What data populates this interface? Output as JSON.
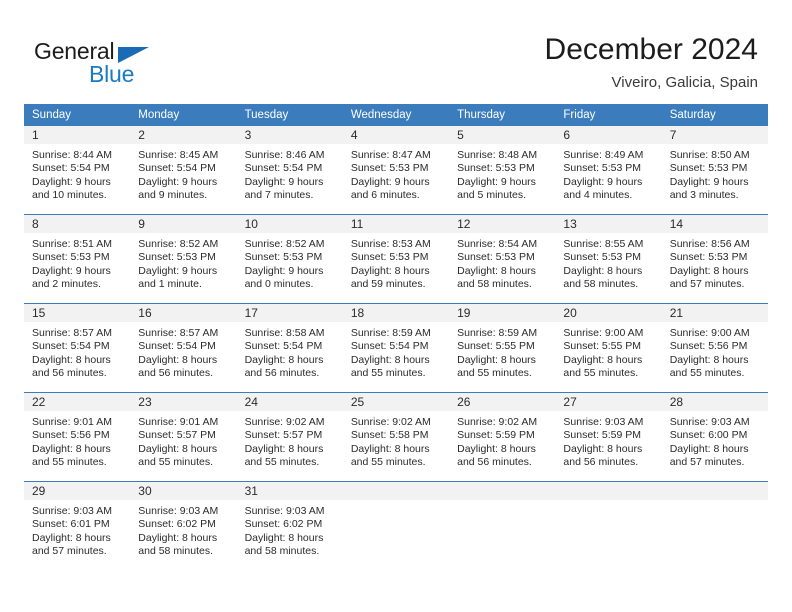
{
  "brand": {
    "name_part1": "General",
    "name_part2": "Blue",
    "triangle_color": "#1a6bb5",
    "blue_color": "#1a7ac4"
  },
  "header": {
    "title": "December 2024",
    "subtitle": "Viveiro, Galicia, Spain"
  },
  "theme": {
    "header_row_color": "#3b7cbd",
    "day_number_band": "#f2f2f2",
    "text_color": "#2b2b2b"
  },
  "calendar": {
    "weekday_headers": [
      "Sunday",
      "Monday",
      "Tuesday",
      "Wednesday",
      "Thursday",
      "Friday",
      "Saturday"
    ],
    "weeks": [
      [
        {
          "day": "1",
          "lines": [
            "Sunrise: 8:44 AM",
            "Sunset: 5:54 PM",
            "Daylight: 9 hours",
            "and 10 minutes."
          ]
        },
        {
          "day": "2",
          "lines": [
            "Sunrise: 8:45 AM",
            "Sunset: 5:54 PM",
            "Daylight: 9 hours",
            "and 9 minutes."
          ]
        },
        {
          "day": "3",
          "lines": [
            "Sunrise: 8:46 AM",
            "Sunset: 5:54 PM",
            "Daylight: 9 hours",
            "and 7 minutes."
          ]
        },
        {
          "day": "4",
          "lines": [
            "Sunrise: 8:47 AM",
            "Sunset: 5:53 PM",
            "Daylight: 9 hours",
            "and 6 minutes."
          ]
        },
        {
          "day": "5",
          "lines": [
            "Sunrise: 8:48 AM",
            "Sunset: 5:53 PM",
            "Daylight: 9 hours",
            "and 5 minutes."
          ]
        },
        {
          "day": "6",
          "lines": [
            "Sunrise: 8:49 AM",
            "Sunset: 5:53 PM",
            "Daylight: 9 hours",
            "and 4 minutes."
          ]
        },
        {
          "day": "7",
          "lines": [
            "Sunrise: 8:50 AM",
            "Sunset: 5:53 PM",
            "Daylight: 9 hours",
            "and 3 minutes."
          ]
        }
      ],
      [
        {
          "day": "8",
          "lines": [
            "Sunrise: 8:51 AM",
            "Sunset: 5:53 PM",
            "Daylight: 9 hours",
            "and 2 minutes."
          ]
        },
        {
          "day": "9",
          "lines": [
            "Sunrise: 8:52 AM",
            "Sunset: 5:53 PM",
            "Daylight: 9 hours",
            "and 1 minute."
          ]
        },
        {
          "day": "10",
          "lines": [
            "Sunrise: 8:52 AM",
            "Sunset: 5:53 PM",
            "Daylight: 9 hours",
            "and 0 minutes."
          ]
        },
        {
          "day": "11",
          "lines": [
            "Sunrise: 8:53 AM",
            "Sunset: 5:53 PM",
            "Daylight: 8 hours",
            "and 59 minutes."
          ]
        },
        {
          "day": "12",
          "lines": [
            "Sunrise: 8:54 AM",
            "Sunset: 5:53 PM",
            "Daylight: 8 hours",
            "and 58 minutes."
          ]
        },
        {
          "day": "13",
          "lines": [
            "Sunrise: 8:55 AM",
            "Sunset: 5:53 PM",
            "Daylight: 8 hours",
            "and 58 minutes."
          ]
        },
        {
          "day": "14",
          "lines": [
            "Sunrise: 8:56 AM",
            "Sunset: 5:53 PM",
            "Daylight: 8 hours",
            "and 57 minutes."
          ]
        }
      ],
      [
        {
          "day": "15",
          "lines": [
            "Sunrise: 8:57 AM",
            "Sunset: 5:54 PM",
            "Daylight: 8 hours",
            "and 56 minutes."
          ]
        },
        {
          "day": "16",
          "lines": [
            "Sunrise: 8:57 AM",
            "Sunset: 5:54 PM",
            "Daylight: 8 hours",
            "and 56 minutes."
          ]
        },
        {
          "day": "17",
          "lines": [
            "Sunrise: 8:58 AM",
            "Sunset: 5:54 PM",
            "Daylight: 8 hours",
            "and 56 minutes."
          ]
        },
        {
          "day": "18",
          "lines": [
            "Sunrise: 8:59 AM",
            "Sunset: 5:54 PM",
            "Daylight: 8 hours",
            "and 55 minutes."
          ]
        },
        {
          "day": "19",
          "lines": [
            "Sunrise: 8:59 AM",
            "Sunset: 5:55 PM",
            "Daylight: 8 hours",
            "and 55 minutes."
          ]
        },
        {
          "day": "20",
          "lines": [
            "Sunrise: 9:00 AM",
            "Sunset: 5:55 PM",
            "Daylight: 8 hours",
            "and 55 minutes."
          ]
        },
        {
          "day": "21",
          "lines": [
            "Sunrise: 9:00 AM",
            "Sunset: 5:56 PM",
            "Daylight: 8 hours",
            "and 55 minutes."
          ]
        }
      ],
      [
        {
          "day": "22",
          "lines": [
            "Sunrise: 9:01 AM",
            "Sunset: 5:56 PM",
            "Daylight: 8 hours",
            "and 55 minutes."
          ]
        },
        {
          "day": "23",
          "lines": [
            "Sunrise: 9:01 AM",
            "Sunset: 5:57 PM",
            "Daylight: 8 hours",
            "and 55 minutes."
          ]
        },
        {
          "day": "24",
          "lines": [
            "Sunrise: 9:02 AM",
            "Sunset: 5:57 PM",
            "Daylight: 8 hours",
            "and 55 minutes."
          ]
        },
        {
          "day": "25",
          "lines": [
            "Sunrise: 9:02 AM",
            "Sunset: 5:58 PM",
            "Daylight: 8 hours",
            "and 55 minutes."
          ]
        },
        {
          "day": "26",
          "lines": [
            "Sunrise: 9:02 AM",
            "Sunset: 5:59 PM",
            "Daylight: 8 hours",
            "and 56 minutes."
          ]
        },
        {
          "day": "27",
          "lines": [
            "Sunrise: 9:03 AM",
            "Sunset: 5:59 PM",
            "Daylight: 8 hours",
            "and 56 minutes."
          ]
        },
        {
          "day": "28",
          "lines": [
            "Sunrise: 9:03 AM",
            "Sunset: 6:00 PM",
            "Daylight: 8 hours",
            "and 57 minutes."
          ]
        }
      ],
      [
        {
          "day": "29",
          "lines": [
            "Sunrise: 9:03 AM",
            "Sunset: 6:01 PM",
            "Daylight: 8 hours",
            "and 57 minutes."
          ]
        },
        {
          "day": "30",
          "lines": [
            "Sunrise: 9:03 AM",
            "Sunset: 6:02 PM",
            "Daylight: 8 hours",
            "and 58 minutes."
          ]
        },
        {
          "day": "31",
          "lines": [
            "Sunrise: 9:03 AM",
            "Sunset: 6:02 PM",
            "Daylight: 8 hours",
            "and 58 minutes."
          ]
        },
        {
          "day": "",
          "lines": []
        },
        {
          "day": "",
          "lines": []
        },
        {
          "day": "",
          "lines": []
        },
        {
          "day": "",
          "lines": []
        }
      ]
    ]
  }
}
